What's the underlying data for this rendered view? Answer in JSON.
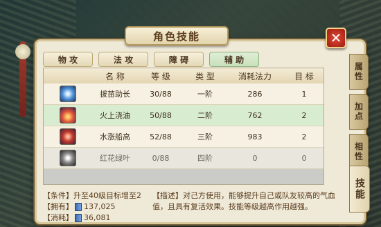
{
  "panel": {
    "title": "角色技能",
    "close_label": "✕"
  },
  "tabs": [
    {
      "label": "物 攻",
      "active": false
    },
    {
      "label": "法 攻",
      "active": false
    },
    {
      "label": "障 碍",
      "active": false
    },
    {
      "label": "辅 助",
      "active": true
    }
  ],
  "table": {
    "headers": [
      "",
      "名 称",
      "等 级",
      "类 型",
      "消耗法力",
      "目 标"
    ],
    "rows": [
      {
        "icon": "skill-icon-lightning",
        "name": "拔苗助长",
        "level": "30/88",
        "type": "一阶",
        "cost": "286",
        "target": "1"
      },
      {
        "icon": "skill-icon-fire",
        "name": "火上浇油",
        "level": "50/88",
        "type": "二阶",
        "cost": "762",
        "target": "2"
      },
      {
        "icon": "skill-icon-water",
        "name": "水涨船高",
        "level": "52/88",
        "type": "三阶",
        "cost": "983",
        "target": "2"
      },
      {
        "icon": "skill-icon-grey",
        "name": "红花绿叶",
        "level": "0/88",
        "type": "四阶",
        "cost": "0",
        "target": "0"
      }
    ]
  },
  "side_tabs": [
    {
      "label": "属性"
    },
    {
      "label": "加点"
    },
    {
      "label": "相性"
    },
    {
      "label": "技能"
    }
  ],
  "info": {
    "condition_label": "【条件】",
    "condition_value": "升至40级目标增至2",
    "owned_label": "【拥有】",
    "owned_value": "137,025",
    "cost_label": "【消耗】",
    "cost_value": "36,081",
    "description": "【描述】对己方使用，能够提升自己或队友较高的气血值，且具有复活效果。技能等级越高作用越强。"
  }
}
